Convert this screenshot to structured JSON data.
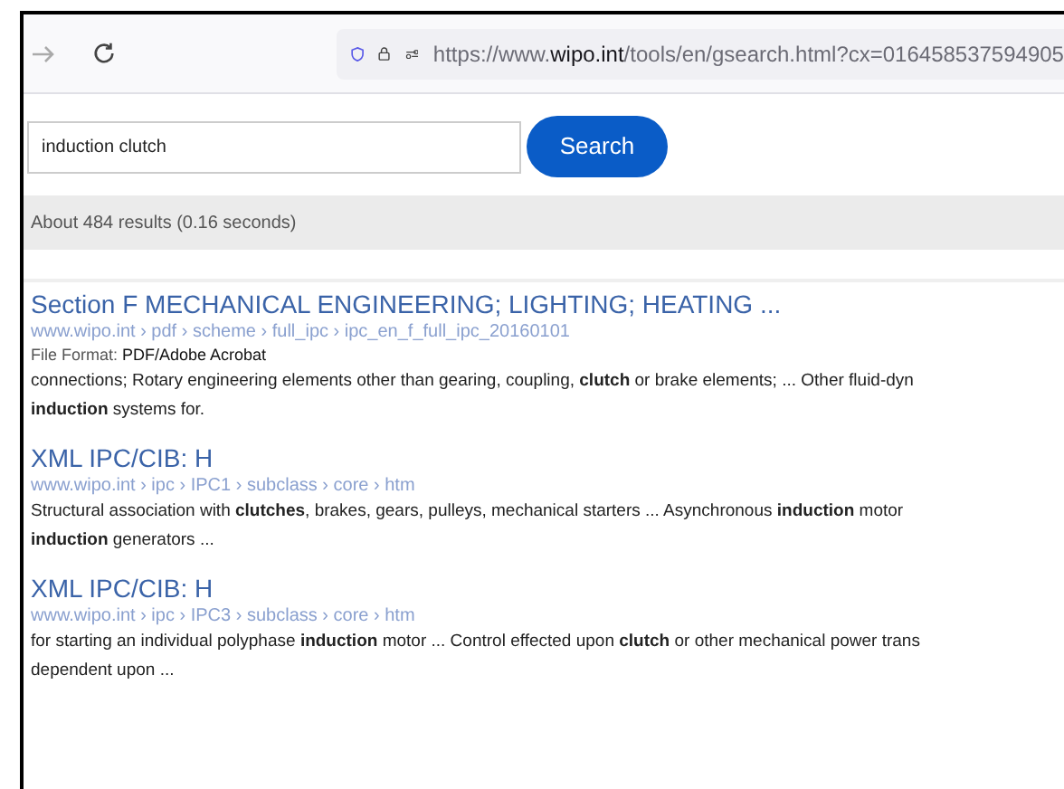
{
  "toolbar": {
    "url_scheme": "https://www.",
    "url_host": "wipo.int",
    "url_path": "/tools/en/gsearch.html?cx=016458537594905"
  },
  "search": {
    "value": "induction clutch",
    "button": "Search"
  },
  "summary": "About 484 results (0.16 seconds)",
  "results": [
    {
      "title": "Section F MECHANICAL ENGINEERING; LIGHTING; HEATING ...",
      "breadcrumb": "www.wipo.int › pdf › scheme › full_ipc › ipc_en_f_full_ipc_20160101",
      "format_label": "File Format:",
      "format": "PDF/Adobe Acrobat",
      "snippet": [
        "connections; Rotary engineering elements other than gearing, coupling, **clutch** or brake elements; ... Other fluid-dyn",
        "**induction** systems for."
      ]
    },
    {
      "title": "XML IPC/CIB: H",
      "breadcrumb": "www.wipo.int › ipc › IPC1 › subclass › core › htm",
      "snippet": [
        "Structural association with **clutches**, brakes, gears, pulleys, mechanical starters ... Asynchronous **induction** motor",
        "**induction** generators ..."
      ]
    },
    {
      "title": "XML IPC/CIB: H",
      "breadcrumb": "www.wipo.int › ipc › IPC3 › subclass › core › htm",
      "snippet": [
        "for starting an individual polyphase **induction** motor ... Control effected upon **clutch** or other mechanical power trans",
        "dependent upon ..."
      ]
    }
  ]
}
